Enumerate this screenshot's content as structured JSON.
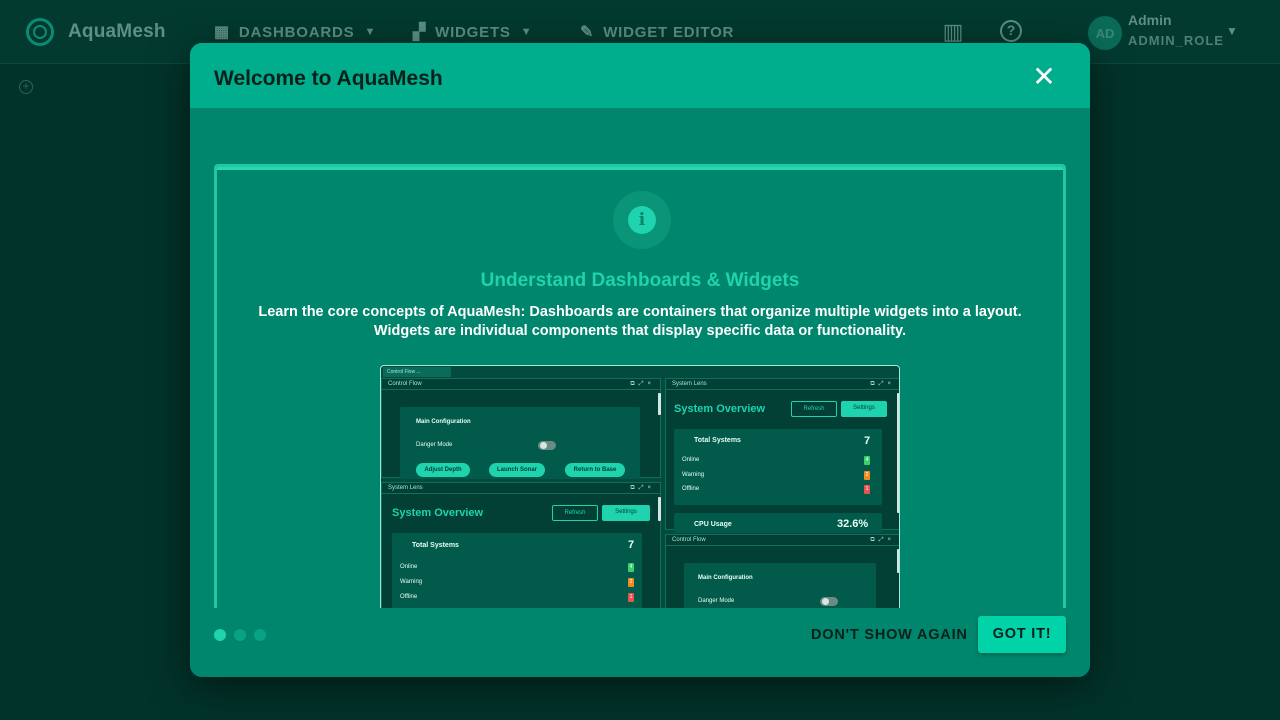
{
  "app": {
    "name": "AquaMesh"
  },
  "nav": {
    "dashboards": "DASHBOARDS",
    "widgets": "WIDGETS",
    "widget_editor": "WIDGET EDITOR"
  },
  "user": {
    "initials": "AD",
    "name": "Admin",
    "role": "ADMIN_ROLE"
  },
  "icons": [
    "logo-icon",
    "dashboards-icon",
    "widgets-icon",
    "pencil-icon",
    "book-icon",
    "help-icon",
    "chevron-down-icon",
    "add-icon",
    "close-icon",
    "info-icon"
  ],
  "colors": {
    "accent": "#1ed3ad",
    "modal": "#00866c",
    "header": "#00ad8d",
    "background": "#02332a"
  },
  "modal": {
    "title": "Welcome to AquaMesh",
    "slide": {
      "title": "Understand Dashboards & Widgets",
      "text": "Learn the core concepts of AquaMesh: Dashboards are containers that organize multiple widgets into a layout. Widgets are individual components that display specific data or functionality."
    },
    "steps": {
      "total": 3,
      "current": 1
    },
    "dont_show_label": "DON'T SHOW AGAIN",
    "got_it_label": "GOT IT!"
  },
  "preview": {
    "tab_label": "Control Flow ...",
    "control_flow": {
      "title": "Control Flow",
      "section": "Main Configuration",
      "toggle_label": "Danger Mode",
      "buttons": [
        "Adjust Depth",
        "Launch Sonar",
        "Return to Base"
      ]
    },
    "system_lens": {
      "title": "System Lens",
      "heading": "System Overview",
      "refresh": "Refresh",
      "settings": "Settings",
      "total_label": "Total Systems",
      "total_value": "7",
      "rows": [
        {
          "label": "Online",
          "value": "4"
        },
        {
          "label": "Warning",
          "value": "2"
        },
        {
          "label": "Offline",
          "value": "1"
        }
      ],
      "cpu_label": "CPU Usage",
      "cpu_value": "32.6%"
    }
  }
}
